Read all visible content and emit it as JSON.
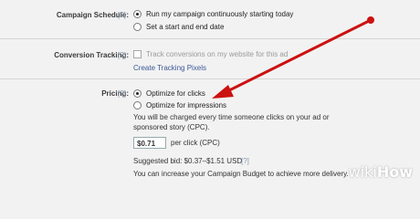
{
  "schedule": {
    "label": "Campaign Schedule:",
    "help": "[?]",
    "options": [
      "Run my campaign continuously starting today",
      "Set a start and end date"
    ],
    "selected": 0
  },
  "conversion": {
    "label": "Conversion Tracking:",
    "help": "[?]",
    "checkbox_label": "Track conversions on my website for this ad",
    "link": "Create Tracking Pixels"
  },
  "pricing": {
    "label": "Pricing:",
    "help": "[?]",
    "options": [
      "Optimize for clicks",
      "Optimize for impressions"
    ],
    "selected": 0,
    "description_line1": "You will be charged every time someone clicks on your ad or",
    "description_line2": "sponsored story (CPC).",
    "bid_value": "$0.71",
    "bid_unit": "per click (CPC)",
    "suggested": "Suggested bid: $0.37–$1.51 USD",
    "suggested_help": "[?]",
    "budget_note": "You can increase your Campaign Budget to achieve more delivery."
  },
  "annotation": {
    "arrow_color": "#cc1111"
  },
  "watermark": {
    "prefix": "wiki",
    "suffix": "How"
  }
}
